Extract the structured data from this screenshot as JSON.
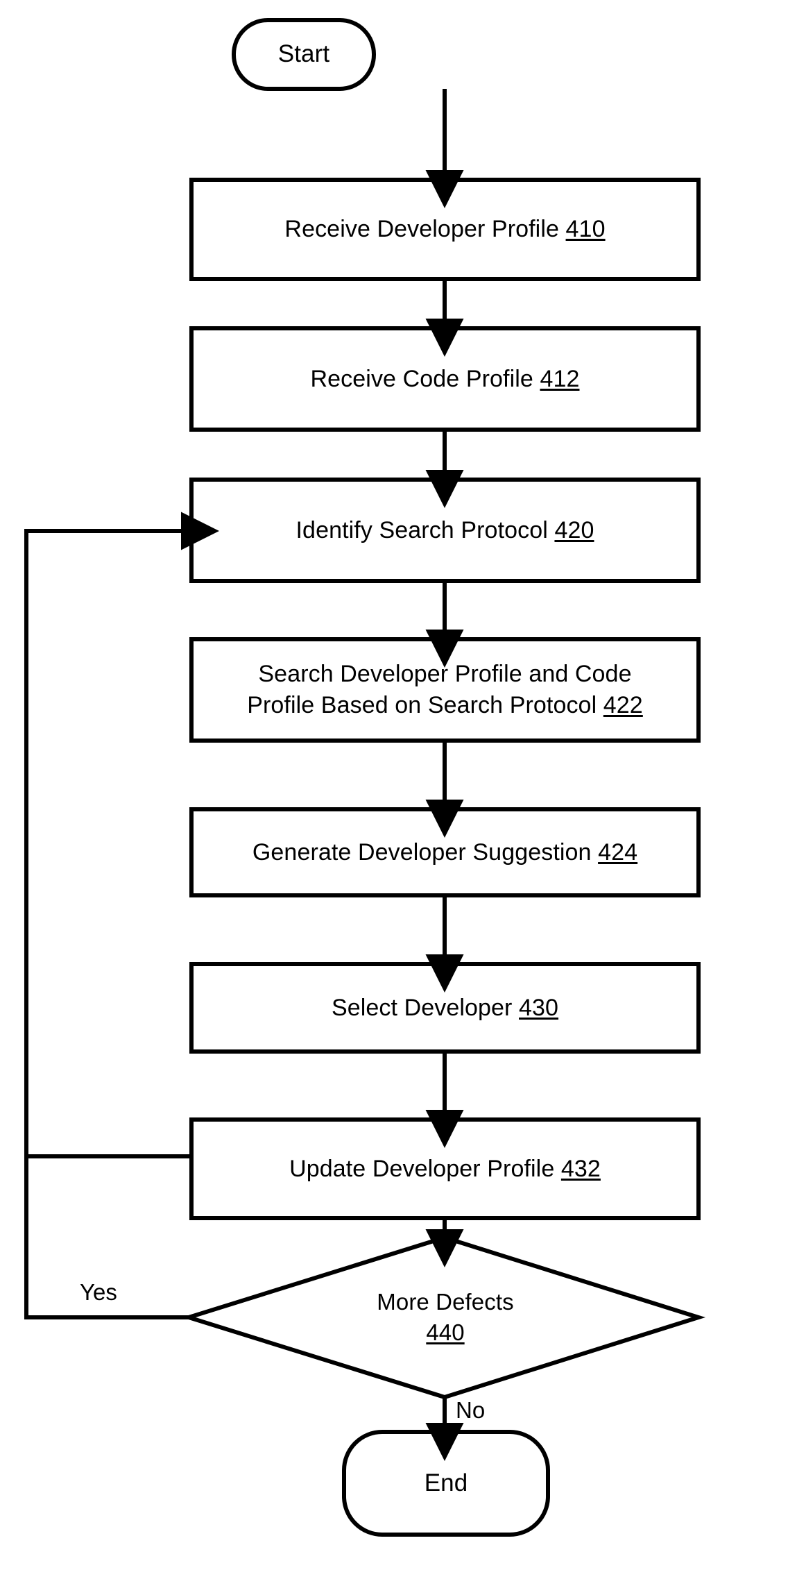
{
  "diagram": {
    "type": "flowchart",
    "title": "",
    "nodes": [
      {
        "id": "start",
        "shape": "terminator",
        "label": "Start",
        "ref": ""
      },
      {
        "id": "n410",
        "shape": "process",
        "label": "Receive Developer Profile",
        "ref": "410"
      },
      {
        "id": "n412",
        "shape": "process",
        "label": "Receive Code Profile",
        "ref": "412"
      },
      {
        "id": "n420",
        "shape": "process",
        "label": "Identify Search Protocol",
        "ref": "420"
      },
      {
        "id": "n422",
        "shape": "process",
        "line1": "Search Developer Profile and Code",
        "line2": "Profile Based on Search Protocol",
        "ref": "422"
      },
      {
        "id": "n424",
        "shape": "process",
        "label": "Generate Developer Suggestion",
        "ref": "424"
      },
      {
        "id": "n430",
        "shape": "process",
        "label": "Select Developer",
        "ref": "430"
      },
      {
        "id": "n432",
        "shape": "process",
        "label": "Update Developer Profile",
        "ref": "432"
      },
      {
        "id": "n440",
        "shape": "decision",
        "label": "More Defects",
        "ref": "440"
      },
      {
        "id": "end",
        "shape": "terminator",
        "label": "End",
        "ref": ""
      }
    ],
    "edge_labels": {
      "yes": "Yes",
      "no": "No"
    },
    "colors": {
      "stroke": "#000000",
      "fill": "#ffffff",
      "text": "#000000"
    }
  }
}
